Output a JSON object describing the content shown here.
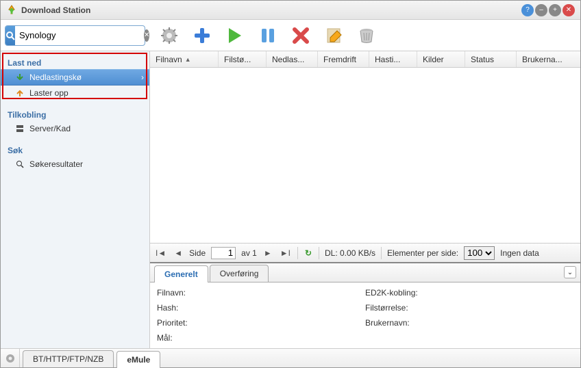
{
  "window": {
    "title": "Download Station"
  },
  "search": {
    "value": "Synology"
  },
  "sidebar": {
    "download": {
      "header": "Last ned",
      "queue": "Nedlastingskø",
      "uploading": "Laster opp"
    },
    "connection": {
      "header": "Tilkobling",
      "server": "Server/Kad"
    },
    "search": {
      "header": "Søk",
      "results": "Søkeresultater"
    }
  },
  "columns": {
    "filename": "Filnavn",
    "filesize": "Filstø...",
    "down": "Nedlas...",
    "progress": "Fremdrift",
    "speed": "Hasti...",
    "sources": "Kilder",
    "status": "Status",
    "user": "Brukerna..."
  },
  "pager": {
    "side_label": "Side",
    "page": "1",
    "of_label": "av 1",
    "dl": "DL: 0.00 KB/s",
    "per_label": "Elementer per side:",
    "per_value": "100",
    "nodata": "Ingen data"
  },
  "detail_tabs": {
    "general": "Generelt",
    "transfer": "Overføring"
  },
  "details": {
    "filename": "Filnavn:",
    "hash": "Hash:",
    "priority": "Prioritet:",
    "target": "Mål:",
    "ed2k": "ED2K-kobling:",
    "filesize": "Filstørrelse:",
    "user": "Brukernavn:"
  },
  "footer_tabs": {
    "bt": "BT/HTTP/FTP/NZB",
    "emule": "eMule"
  }
}
